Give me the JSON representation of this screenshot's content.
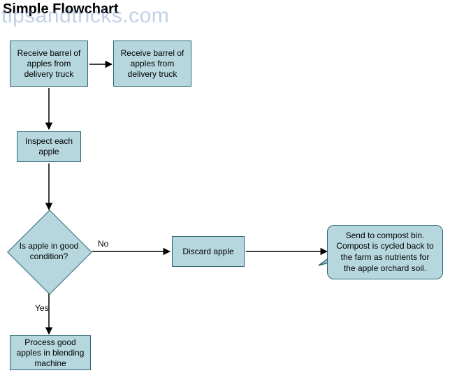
{
  "title": "Simple Flowchart",
  "watermark": "tipsandtricks.com",
  "nodes": {
    "receive1": "Receive barrel of apples from delivery truck",
    "receive2": "Receive barrel of apples from delivery truck",
    "inspect": "Inspect each apple",
    "decision": "Is apple in good condition?",
    "discard": "Discard apple",
    "compost": "Send to compost bin. Compost is cycled back to the farm as nutrients for the apple orchard soil.",
    "process": "Process good apples in blending machine"
  },
  "edge_labels": {
    "no": "No",
    "yes": "Yes"
  },
  "colors": {
    "node_fill": "#b6d7de",
    "node_border": "#2b6673",
    "arrow": "#000000"
  }
}
